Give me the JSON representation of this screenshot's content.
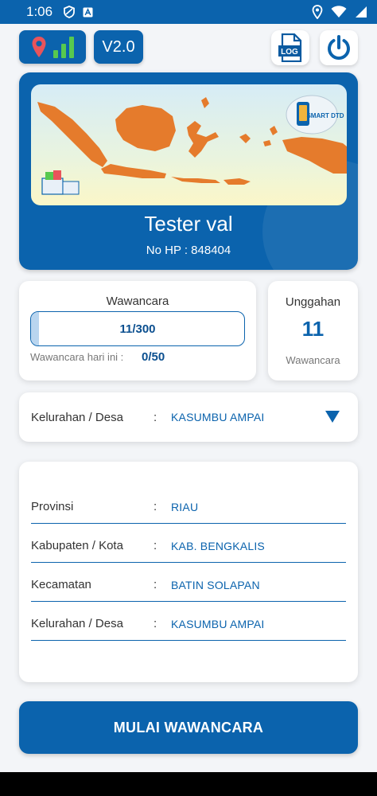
{
  "status_bar": {
    "time": "1:06"
  },
  "top_bar": {
    "version_label": "V2.0",
    "log_label": "LOG"
  },
  "profile": {
    "banner_logo_text": "SMART DTD",
    "name": "Tester val",
    "phone": "No HP : 848404"
  },
  "wawancara": {
    "title": "Wawancara",
    "progress_text": "11/300",
    "progress_fraction": 0.0367,
    "today_label": "Wawancara hari ini :",
    "today_value": "0/50"
  },
  "unggahan": {
    "title": "Unggahan",
    "count": "11",
    "label": "Wawancara"
  },
  "desa_select": {
    "label": "Kelurahan / Desa",
    "colon": ":",
    "value": "KASUMBU AMPAI"
  },
  "details": [
    {
      "label": "Provinsi",
      "colon": ":",
      "value": "RIAU"
    },
    {
      "label": "Kabupaten / Kota",
      "colon": ":",
      "value": "KAB. BENGKALIS"
    },
    {
      "label": "Kecamatan",
      "colon": ":",
      "value": "BATIN SOLAPAN"
    },
    {
      "label": "Kelurahan / Desa",
      "colon": ":",
      "value": "KASUMBU AMPAI"
    }
  ],
  "start_button": {
    "label": "MULAI WAWANCARA"
  },
  "colors": {
    "primary": "#0b63ad",
    "map_orange": "#e57b2c",
    "signal_green": "#57c94f",
    "pin_red": "#e8545b"
  }
}
